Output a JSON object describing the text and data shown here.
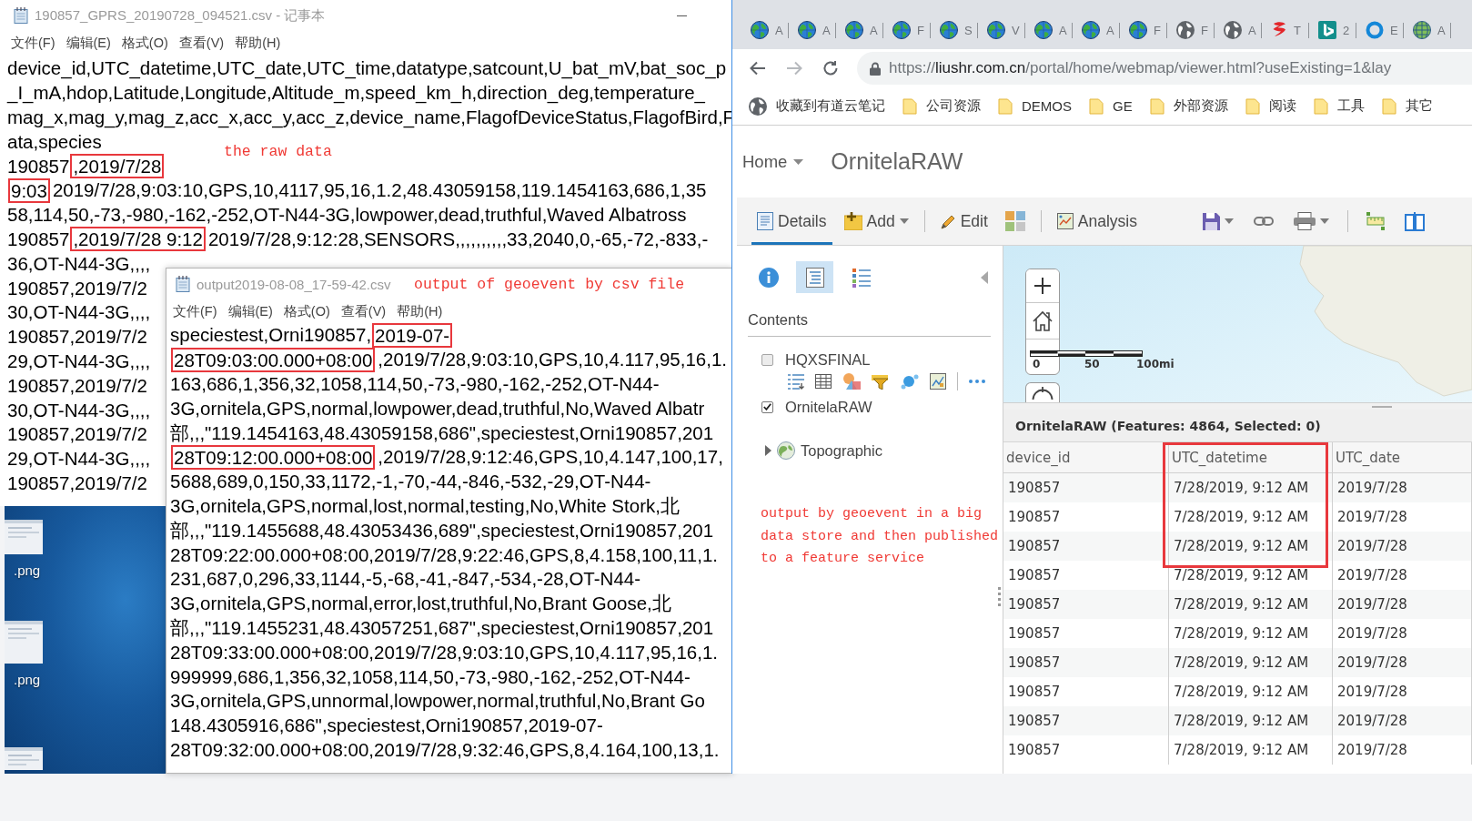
{
  "notepads": [
    {
      "title": "190857_GPRS_20190728_094521.csv - 记事本",
      "minimize_button": true,
      "menu": [
        "文件(F)",
        "编辑(E)",
        "格式(O)",
        "查看(V)",
        "帮助(H)"
      ],
      "annotation": "the raw data",
      "lines": [
        [
          {
            "text": "device_id,UTC_datetime,UTC_date,UTC_time,datatype,satcount,U_bat_mV,bat_soc_p",
            "boxed": false
          }
        ],
        [
          {
            "text": "_I_mA,hdop,Latitude,Longitude,Altitude_m,speed_km_h,direction_deg,temperature_",
            "boxed": false
          }
        ],
        [
          {
            "text": "mag_x,mag_y,mag_z,acc_x,acc_y,acc_z,device_name,FlagofDeviceStatus,FlagofBird,F",
            "boxed": false
          }
        ],
        [
          {
            "text": "ata,species",
            "boxed": false
          }
        ],
        [
          {
            "text": "190857",
            "boxed": false
          },
          {
            "text": ",2019/7/28",
            "boxed": true
          }
        ],
        [
          {
            "text": "9:03",
            "boxed": true
          },
          {
            "text": "2019/7/28,9:03:10,GPS,10,4117,95,16,1.2,48.43059158,119.1454163,686,1,35",
            "boxed": false
          }
        ],
        [
          {
            "text": "58,114,50,-73,-980,-162,-252,OT-N44-3G,lowpower,dead,truthful,Waved Albatross",
            "boxed": false
          }
        ],
        [
          {
            "text": "190857",
            "boxed": false
          },
          {
            "text": ",2019/7/28 9:12",
            "boxed": true
          },
          {
            "text": "2019/7/28,9:12:28,SENSORS,,,,,,,,,,33,2040,0,-65,-72,-833,-",
            "boxed": false
          }
        ],
        [
          {
            "text": "36,OT-N44-3G,,,,",
            "boxed": false
          }
        ],
        [
          {
            "text": "190857,2019/7/2",
            "boxed": false
          }
        ],
        [
          {
            "text": "30,OT-N44-3G,,,,",
            "boxed": false
          }
        ],
        [
          {
            "text": "190857,2019/7/2",
            "boxed": false
          }
        ],
        [
          {
            "text": "29,OT-N44-3G,,,,",
            "boxed": false
          }
        ],
        [
          {
            "text": "190857,2019/7/2",
            "boxed": false
          }
        ],
        [
          {
            "text": "30,OT-N44-3G,,,,",
            "boxed": false
          }
        ],
        [
          {
            "text": "190857,2019/7/2",
            "boxed": false
          }
        ],
        [
          {
            "text": "29,OT-N44-3G,,,,",
            "boxed": false
          }
        ],
        [
          {
            "text": "190857,2019/7/2",
            "boxed": false
          }
        ]
      ]
    },
    {
      "title": "output2019-08-08_17-59-42.csv",
      "minimize_button": false,
      "menu": [
        "文件(F)",
        "编辑(E)",
        "格式(O)",
        "查看(V)",
        "帮助(H)"
      ],
      "annotation": "output of geoevent by csv file",
      "lines": [
        [
          {
            "text": "speciestest,Orni190857,",
            "boxed": false
          },
          {
            "text": "2019-07-",
            "boxed": true
          }
        ],
        [
          {
            "text": "28T09:03:00.000+08:00",
            "boxed": true
          },
          {
            "text": ",2019/7/28,9:03:10,GPS,10,4.117,95,16,1.",
            "boxed": false
          }
        ],
        [
          {
            "text": "163,686,1,356,32,1058,114,50,-73,-980,-162,-252,OT-N44-",
            "boxed": false
          }
        ],
        [
          {
            "text": "3G,ornitela,GPS,normal,lowpower,dead,truthful,No,Waved Albatr",
            "boxed": false
          }
        ],
        [
          {
            "text": "部,,,\"119.1454163,48.43059158,686\",speciestest,Orni190857,201",
            "boxed": false
          }
        ],
        [
          {
            "text": "28T09:12:00.000+08:00",
            "boxed": true
          },
          {
            "text": ",2019/7/28,9:12:46,GPS,10,4.147,100,17,",
            "boxed": false
          }
        ],
        [
          {
            "text": "5688,689,0,150,33,1172,-1,-70,-44,-846,-532,-29,OT-N44-",
            "boxed": false
          }
        ],
        [
          {
            "text": "3G,ornitela,GPS,normal,lost,normal,testing,No,White Stork,北",
            "boxed": false
          }
        ],
        [
          {
            "text": "部,,,\"119.1455688,48.43053436,689\",speciestest,Orni190857,201",
            "boxed": false
          }
        ],
        [
          {
            "text": "28T09:22:00.000+08:00,2019/7/28,9:22:46,GPS,8,4.158,100,11,1.",
            "boxed": false
          }
        ],
        [
          {
            "text": "231,687,0,296,33,1144,-5,-68,-41,-847,-534,-28,OT-N44-",
            "boxed": false
          }
        ],
        [
          {
            "text": "3G,ornitela,GPS,normal,error,lost,truthful,No,Brant Goose,北",
            "boxed": false
          }
        ],
        [
          {
            "text": "部,,,\"119.1455231,48.43057251,687\",speciestest,Orni190857,201",
            "boxed": false
          }
        ],
        [
          {
            "text": "28T09:33:00.000+08:00,2019/7/28,9:03:10,GPS,10,4.117,95,16,1.",
            "boxed": false
          }
        ],
        [
          {
            "text": "999999,686,1,356,32,1058,114,50,-73,-980,-162,-252,OT-N44-",
            "boxed": false
          }
        ],
        [
          {
            "text": "3G,ornitela,GPS,unnormal,lowpower,normal,truthful,No,Brant Go",
            "boxed": false
          }
        ],
        [
          {
            "text": "148.4305916,686\",speciestest,Orni190857,2019-07-",
            "boxed": false
          }
        ],
        [
          {
            "text": "28T09:32:00.000+08:00,2019/7/28,9:32:46,GPS,8,4.164,100,13,1.",
            "boxed": false
          }
        ]
      ]
    }
  ],
  "desktop": {
    "files": [
      {
        "label": ".png"
      },
      {
        "label": ".png"
      }
    ]
  },
  "browser": {
    "tabs": [
      {
        "kind": "globe",
        "title": "A"
      },
      {
        "kind": "globe",
        "title": "A"
      },
      {
        "kind": "globe",
        "title": "A"
      },
      {
        "kind": "globe",
        "title": "F"
      },
      {
        "kind": "globe",
        "title": "S"
      },
      {
        "kind": "globe",
        "title": "V"
      },
      {
        "kind": "globe",
        "title": "A"
      },
      {
        "kind": "globe",
        "title": "A"
      },
      {
        "kind": "globe",
        "title": "F"
      },
      {
        "kind": "plain",
        "title": "F"
      },
      {
        "kind": "plain",
        "title": "A"
      },
      {
        "kind": "glyph",
        "title": "T"
      },
      {
        "kind": "tile",
        "title": "2"
      },
      {
        "kind": "ring",
        "title": "E"
      },
      {
        "kind": "map",
        "title": "A"
      }
    ],
    "navigation": {
      "back": {
        "disabled": false
      },
      "forward": {
        "disabled": true
      }
    },
    "url": {
      "scheme": "https://",
      "host": "liushr.com.cn",
      "path": "/portal/home/webmap/viewer.html?useExisting=1&lay"
    },
    "bookmarks": [
      {
        "kind": "page",
        "label": "收藏到有道云笔记"
      },
      {
        "kind": "folder",
        "label": "公司资源"
      },
      {
        "kind": "folder",
        "label": "DEMOS"
      },
      {
        "kind": "folder",
        "label": "GE"
      },
      {
        "kind": "folder",
        "label": "外部资源"
      },
      {
        "kind": "folder",
        "label": "阅读"
      },
      {
        "kind": "folder",
        "label": "工具"
      },
      {
        "kind": "folder",
        "label": "其它"
      }
    ]
  },
  "map_viewer": {
    "home": "Home",
    "title": "OrnitelaRAW",
    "toolbar": {
      "details": {
        "label": "Details",
        "selected": true
      },
      "add": {
        "label": "Add",
        "selected": false
      },
      "edit": {
        "label": "Edit",
        "selected": false
      },
      "analysis": {
        "label": "Analysis",
        "selected": false
      }
    },
    "panel_tabs": [
      {
        "kind": "about",
        "selected": false
      },
      {
        "kind": "contents",
        "selected": true
      },
      {
        "kind": "legend",
        "selected": false
      }
    ],
    "contents_heading": "Contents",
    "layers": [
      {
        "name": "HQXSFINAL",
        "checked": false,
        "tools_shown": true
      },
      {
        "name": "OrnitelaRAW",
        "checked": true,
        "tools_shown": false
      }
    ],
    "basemap": {
      "name": "Topographic",
      "expanded": false
    },
    "scale_labels": [
      "0",
      "50",
      "100mi"
    ],
    "annotation": "output by geoevent in a big data store and then published to a feature service",
    "table": {
      "title": "OrnitelaRAW (Features: 4864, Selected: 0)",
      "columns": [
        {
          "label": "device_id",
          "boxed": false
        },
        {
          "label": "UTC_datetime",
          "boxed": true
        },
        {
          "label": "UTC_date",
          "boxed": false
        }
      ],
      "rows": [
        {
          "cells": [
            "190857",
            "7/28/2019, 9:12 AM",
            "2019/7/28"
          ],
          "boxed": true
        },
        {
          "cells": [
            "190857",
            "7/28/2019, 9:12 AM",
            "2019/7/28"
          ],
          "boxed": true
        },
        {
          "cells": [
            "190857",
            "7/28/2019, 9:12 AM",
            "2019/7/28"
          ],
          "boxed": true
        },
        {
          "cells": [
            "190857",
            "7/28/2019, 9:12 AM",
            "2019/7/28"
          ],
          "boxed": false
        },
        {
          "cells": [
            "190857",
            "7/28/2019, 9:12 AM",
            "2019/7/28"
          ],
          "boxed": false
        },
        {
          "cells": [
            "190857",
            "7/28/2019, 9:12 AM",
            "2019/7/28"
          ],
          "boxed": false
        },
        {
          "cells": [
            "190857",
            "7/28/2019, 9:12 AM",
            "2019/7/28"
          ],
          "boxed": false
        },
        {
          "cells": [
            "190857",
            "7/28/2019, 9:12 AM",
            "2019/7/28"
          ],
          "boxed": false
        },
        {
          "cells": [
            "190857",
            "7/28/2019, 9:12 AM",
            "2019/7/28"
          ],
          "boxed": false
        },
        {
          "cells": [
            "190857",
            "7/28/2019, 9:12 AM",
            "2019/7/28"
          ],
          "boxed": false
        }
      ]
    }
  }
}
